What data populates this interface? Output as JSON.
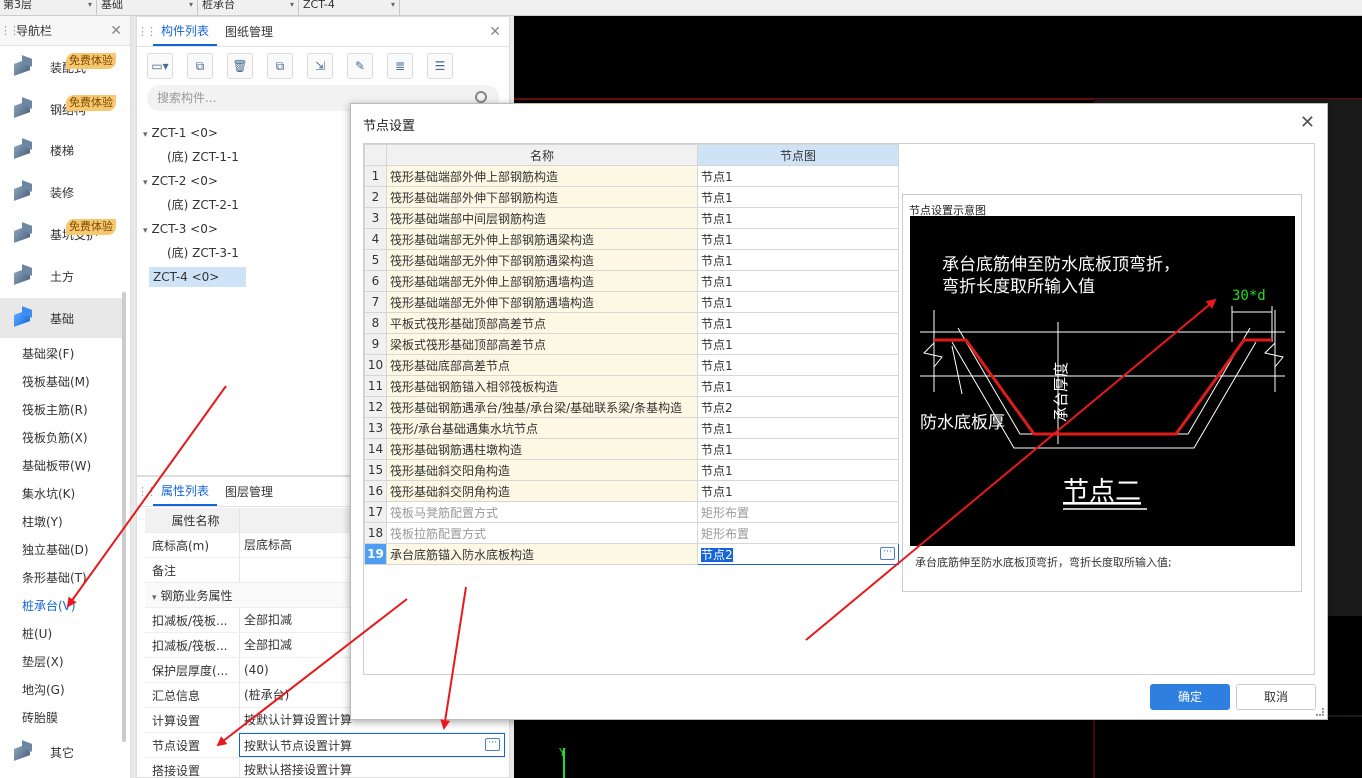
{
  "topbar": {
    "dropdowns": [
      {
        "label": "第3层"
      },
      {
        "label": "基础"
      },
      {
        "label": "桩承台"
      },
      {
        "label": "ZCT-4"
      }
    ]
  },
  "nav": {
    "title": "导航栏",
    "items": [
      {
        "label": "装配式",
        "badge": "免费体验"
      },
      {
        "label": "钢结构",
        "badge": "免费体验"
      },
      {
        "label": "楼梯",
        "badge": ""
      },
      {
        "label": "装修",
        "badge": ""
      },
      {
        "label": "基坑支护",
        "badge": "免费体验"
      },
      {
        "label": "土方",
        "badge": ""
      },
      {
        "label": "基础",
        "badge": ""
      }
    ],
    "sub_items": [
      "基础梁(F)",
      "筏板基础(M)",
      "筏板主筋(R)",
      "筏板负筋(X)",
      "基础板带(W)",
      "集水坑(K)",
      "柱墩(Y)",
      "独立基础(D)",
      "条形基础(T)",
      "桩承台(V)",
      "桩(U)",
      "垫层(X)",
      "地沟(G)",
      "砖胎膜"
    ],
    "selected_sub": "桩承台(V)",
    "other": "其它"
  },
  "components": {
    "tabs": [
      "构件列表",
      "图纸管理"
    ],
    "search_placeholder": "搜索构件...",
    "tree": [
      {
        "label": "ZCT-1 <0>",
        "level": 0
      },
      {
        "label": "(底)  ZCT-1-1",
        "level": 1
      },
      {
        "label": "ZCT-2 <0>",
        "level": 0
      },
      {
        "label": "(底)  ZCT-2-1",
        "level": 1
      },
      {
        "label": "ZCT-3 <0>",
        "level": 0
      },
      {
        "label": "(底)  ZCT-3-1",
        "level": 1
      },
      {
        "label": "ZCT-4 <0>",
        "level": 0
      }
    ]
  },
  "props": {
    "tabs": [
      "属性列表",
      "图层管理"
    ],
    "header": {
      "name": "属性名称",
      "value": "属性"
    },
    "rows": [
      {
        "name": "底标高(m)",
        "value": "层底标高"
      },
      {
        "name": "备注",
        "value": ""
      },
      {
        "name": "钢筋业务属性",
        "value": "",
        "group": true
      },
      {
        "name": "扣减板/筏板...",
        "value": "全部扣减"
      },
      {
        "name": "扣减板/筏板...",
        "value": "全部扣减"
      },
      {
        "name": "保护层厚度(...",
        "value": "(40)"
      },
      {
        "name": "汇总信息",
        "value": "(桩承台)"
      },
      {
        "name": "计算设置",
        "value": "按默认计算设置计算"
      },
      {
        "name": "节点设置",
        "value": "按默认节点设置计算"
      },
      {
        "name": "搭接设置",
        "value": "按默认搭接设置计算"
      }
    ]
  },
  "dialog": {
    "title": "节点设置",
    "col_name": "名称",
    "col_node": "节点图",
    "rows": [
      {
        "n": "1",
        "name": "筏形基础端部外伸上部钢筋构造",
        "value": "节点1"
      },
      {
        "n": "2",
        "name": "筏形基础端部外伸下部钢筋构造",
        "value": "节点1"
      },
      {
        "n": "3",
        "name": "筏形基础端部中间层钢筋构造",
        "value": "节点1"
      },
      {
        "n": "4",
        "name": "筏形基础端部无外伸上部钢筋遇梁构造",
        "value": "节点1"
      },
      {
        "n": "5",
        "name": "筏形基础端部无外伸下部钢筋遇梁构造",
        "value": "节点1"
      },
      {
        "n": "6",
        "name": "筏形基础端部无外伸上部钢筋遇墙构造",
        "value": "节点1"
      },
      {
        "n": "7",
        "name": "筏形基础端部无外伸下部钢筋遇墙构造",
        "value": "节点1"
      },
      {
        "n": "8",
        "name": "平板式筏形基础顶部高差节点",
        "value": "节点1"
      },
      {
        "n": "9",
        "name": "梁板式筏形基础顶部高差节点",
        "value": "节点1"
      },
      {
        "n": "10",
        "name": "筏形基础底部高差节点",
        "value": "节点1"
      },
      {
        "n": "11",
        "name": "筏形基础钢筋锚入相邻筏板构造",
        "value": "节点1"
      },
      {
        "n": "12",
        "name": "筏形基础钢筋遇承台/独基/承台梁/基础联系梁/条基构造",
        "value": "节点2"
      },
      {
        "n": "13",
        "name": "筏形/承台基础遇集水坑节点",
        "value": "节点1"
      },
      {
        "n": "14",
        "name": "筏形基础钢筋遇柱墩构造",
        "value": "节点1"
      },
      {
        "n": "15",
        "name": "筏形基础斜交阳角构造",
        "value": "节点1"
      },
      {
        "n": "16",
        "name": "筏形基础斜交阴角构造",
        "value": "节点1"
      },
      {
        "n": "17",
        "name": "筏板马凳筋配置方式",
        "value": "矩形布置",
        "gray": true
      },
      {
        "n": "18",
        "name": "筏板拉筋配置方式",
        "value": "矩形布置",
        "gray": true
      },
      {
        "n": "19",
        "name": "承台底筋锚入防水底板构造",
        "value": "节点2",
        "current": true
      }
    ],
    "diagram": {
      "title": "节点设置示意图",
      "text_top1": "承台底筋伸至防水底板顶弯折，",
      "text_top2": "弯折长度取所输入值",
      "dim": "30*d",
      "label_thick": "承台厚度",
      "label_plate": "防水底板厚",
      "label_node": "节点二",
      "description": "承台底筋伸至防水底板顶弯折，弯折长度取所输入值;"
    },
    "ok": "确定",
    "cancel": "取消"
  },
  "colors": {
    "accent": "#1565d8",
    "annotation_arrow": "#e8191d",
    "rebar_red": "#e01b1b",
    "dim_green": "#22dd22"
  }
}
